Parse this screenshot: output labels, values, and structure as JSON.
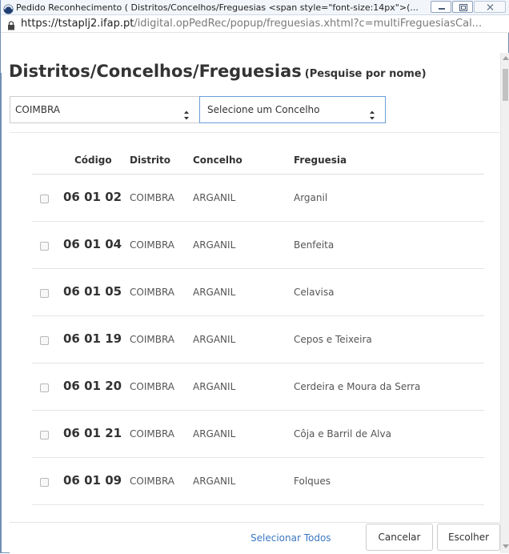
{
  "window": {
    "title": "Pedido Reconhecimento ( Distritos/Concelhos/Freguesias <span style=\"font-size:14px\">(...",
    "address_domain": "https://tstaplj2.ifap.pt",
    "address_path": "/idigital.opPedRec/popup/freguesias.xhtml?c=multiFreguesiasCal..."
  },
  "page": {
    "title": "Distritos/Concelhos/Freguesias",
    "subtitle": "(Pesquise por nome)"
  },
  "filters": {
    "distrito_value": "COIMBRA",
    "concelho_value": "Selecione um Concelho"
  },
  "table": {
    "headers": {
      "codigo": "Código",
      "distrito": "Distrito",
      "concelho": "Concelho",
      "freguesia": "Freguesia"
    },
    "rows": [
      {
        "codigo": "06 01 02",
        "distrito": "COIMBRA",
        "concelho": "ARGANIL",
        "freguesia": "Arganil",
        "checked": false
      },
      {
        "codigo": "06 01 04",
        "distrito": "COIMBRA",
        "concelho": "ARGANIL",
        "freguesia": "Benfeita",
        "checked": false
      },
      {
        "codigo": "06 01 05",
        "distrito": "COIMBRA",
        "concelho": "ARGANIL",
        "freguesia": "Celavisa",
        "checked": false
      },
      {
        "codigo": "06 01 19",
        "distrito": "COIMBRA",
        "concelho": "ARGANIL",
        "freguesia": "Cepos e Teixeira",
        "checked": false
      },
      {
        "codigo": "06 01 20",
        "distrito": "COIMBRA",
        "concelho": "ARGANIL",
        "freguesia": "Cerdeira e Moura da Serra",
        "checked": false
      },
      {
        "codigo": "06 01 21",
        "distrito": "COIMBRA",
        "concelho": "ARGANIL",
        "freguesia": "Côja e Barril de Alva",
        "checked": false
      },
      {
        "codigo": "06 01 09",
        "distrito": "COIMBRA",
        "concelho": "ARGANIL",
        "freguesia": "Folques",
        "checked": false
      }
    ]
  },
  "footer": {
    "select_all": "Selecionar Todos",
    "cancel": "Cancelar",
    "choose": "Escolher"
  },
  "icons": {
    "app": "browser-app-icon",
    "lock": "lock-icon",
    "select_arrows": "updown-arrows-icon"
  },
  "colors": {
    "window_border": "#6f8fb3",
    "link": "#3a78c3",
    "focus_border": "#6a9fd6"
  }
}
